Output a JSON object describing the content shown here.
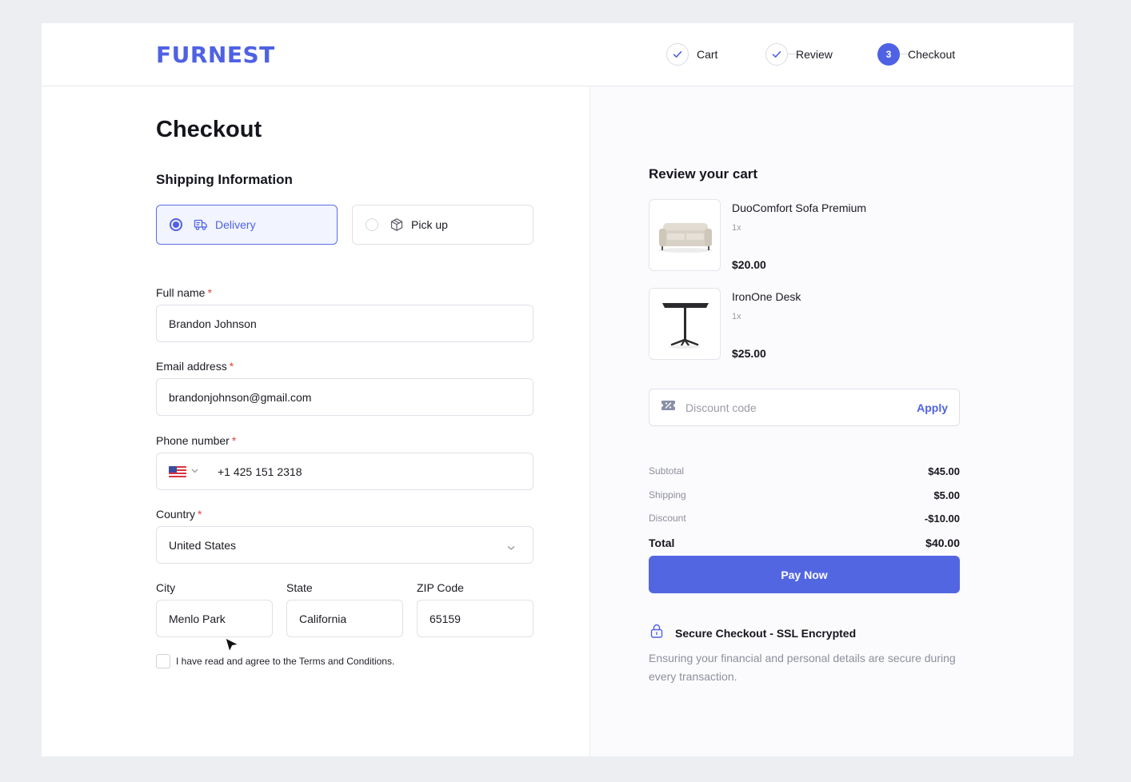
{
  "brand": {
    "logo": "FURNEST",
    "accent": "#4f62e3"
  },
  "stepper": {
    "steps": [
      {
        "label": "Cart",
        "state": "done"
      },
      {
        "label": "Review",
        "state": "done"
      },
      {
        "label": "Checkout",
        "state": "active",
        "number": "3"
      }
    ]
  },
  "checkout": {
    "title": "Checkout",
    "shipping_title": "Shipping Information",
    "options": {
      "delivery": "Delivery",
      "pickup": "Pick up",
      "selected": "Delivery"
    },
    "fields": {
      "full_name": {
        "label": "Full name",
        "value": "Brandon Johnson"
      },
      "email": {
        "label": "Email address",
        "value": "brandonjohnson@gmail.com"
      },
      "phone": {
        "label": "Phone number",
        "value": "+1 425 151 2318",
        "country_flag": "us-flag-icon"
      },
      "country": {
        "label": "Country",
        "value": "United States"
      },
      "city": {
        "label": "City",
        "value": "Menlo Park"
      },
      "state": {
        "label": "State",
        "value": "California"
      },
      "zip": {
        "label": "ZIP Code",
        "value": "65159"
      }
    },
    "required_mark": "*",
    "terms": "I have read and agree to the Terms and Conditions."
  },
  "cart": {
    "title": "Review your cart",
    "items": [
      {
        "name": "DuoComfort Sofa Premium",
        "qty": "1x",
        "price": "$20.00",
        "image": "sofa"
      },
      {
        "name": "IronOne Desk",
        "qty": "1x",
        "price": "$25.00",
        "image": "desk"
      }
    ],
    "discount": {
      "placeholder": "Discount code",
      "apply": "Apply"
    },
    "summary": {
      "subtotal": {
        "label": "Subtotal",
        "value": "$45.00"
      },
      "shipping": {
        "label": "Shipping",
        "value": "$5.00"
      },
      "discount": {
        "label": "Discount",
        "value": "-$10.00"
      },
      "total": {
        "label": "Total",
        "value": "$40.00"
      }
    },
    "pay_button": "Pay Now",
    "secure": {
      "title": "Secure Checkout - SSL Encrypted",
      "description": "Ensuring your financial and personal details are secure during every transaction."
    }
  }
}
